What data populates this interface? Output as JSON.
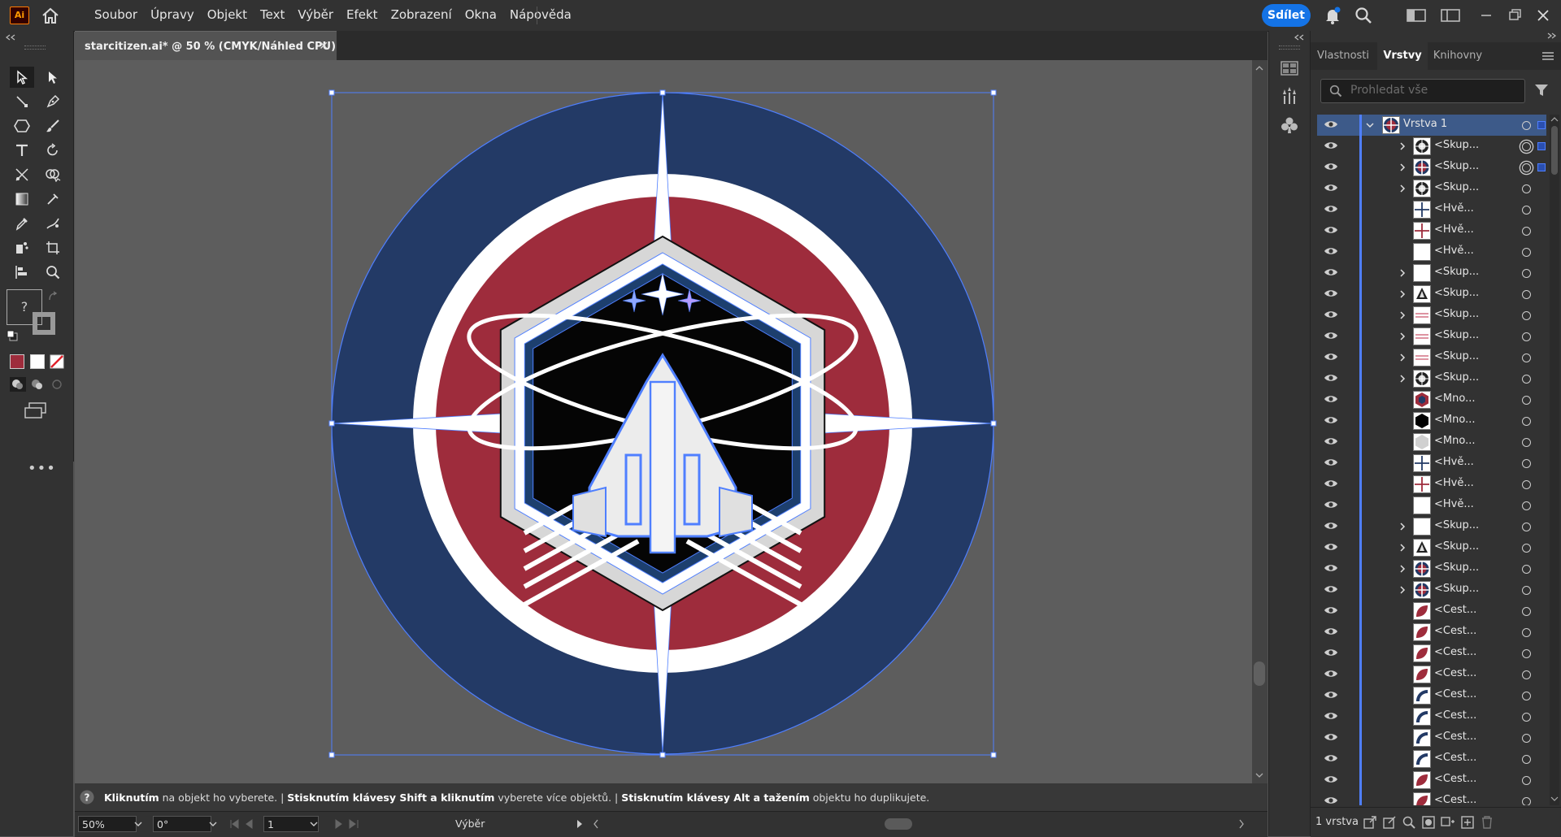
{
  "app": {
    "logo": "Ai"
  },
  "menu": [
    "Soubor",
    "Úpravy",
    "Objekt",
    "Text",
    "Výběr",
    "Efekt",
    "Zobrazení",
    "Okna",
    "Nápověda"
  ],
  "share_label": "Sdílet",
  "document": {
    "tab_title": "starcitizen.ai* @ 50 % (CMYK/Náhled CPU)",
    "close": "✕"
  },
  "colors": {
    "navy": "#233a66",
    "red": "#9e2c3c",
    "white": "#ffffff",
    "accent": "#1473e6",
    "selection": "#4f7fff"
  },
  "hint": {
    "p1b": "Kliknutím",
    "p1": " na objekt ho vyberete.  |  ",
    "p2b": "Stisknutím klávesy Shift a kliknutím",
    "p2": " vyberete více objektů.  |  ",
    "p3b": "Stisknutím klávesy Alt a tažením",
    "p3": " objektu ho duplikujete."
  },
  "status": {
    "zoom": "50%",
    "rotation": "0°",
    "artboard": "1",
    "tool": "Výběr"
  },
  "panel": {
    "tabs": [
      "Vlastnosti",
      "Vrstvy",
      "Knihovny"
    ],
    "active_tab": "Vrstvy",
    "search_placeholder": "Prohledat vše",
    "layer_count": "1 vrstva",
    "layers": [
      {
        "name": "Vrstva 1",
        "level": 0,
        "expand": "down",
        "thumb": "emblem",
        "target": "ring-dot",
        "sel": true
      },
      {
        "name": "<Skup...",
        "level": 1,
        "expand": "right",
        "thumb": "gear",
        "target": "double",
        "sel": true
      },
      {
        "name": "<Skup...",
        "level": 1,
        "expand": "right",
        "thumb": "redcircle",
        "target": "double",
        "sel": true
      },
      {
        "name": "<Skup...",
        "level": 1,
        "expand": "right",
        "thumb": "gear",
        "target": "single"
      },
      {
        "name": "<Hvě...",
        "level": 1,
        "expand": "",
        "thumb": "cross-blue",
        "target": "single"
      },
      {
        "name": "<Hvě...",
        "level": 1,
        "expand": "",
        "thumb": "cross-red",
        "target": "single"
      },
      {
        "name": "<Hvě...",
        "level": 1,
        "expand": "",
        "thumb": "white",
        "target": "single"
      },
      {
        "name": "<Skup...",
        "level": 1,
        "expand": "right",
        "thumb": "white",
        "target": "single"
      },
      {
        "name": "<Skup...",
        "level": 1,
        "expand": "right",
        "thumb": "ship",
        "target": "single"
      },
      {
        "name": "<Skup...",
        "level": 1,
        "expand": "right",
        "thumb": "lines-red",
        "target": "single"
      },
      {
        "name": "<Skup...",
        "level": 1,
        "expand": "right",
        "thumb": "lines-red",
        "target": "single"
      },
      {
        "name": "<Skup...",
        "level": 1,
        "expand": "right",
        "thumb": "lines-red",
        "target": "single"
      },
      {
        "name": "<Skup...",
        "level": 1,
        "expand": "right",
        "thumb": "gear",
        "target": "single"
      },
      {
        "name": "<Mno...",
        "level": 1,
        "expand": "",
        "thumb": "hex-red",
        "target": "single"
      },
      {
        "name": "<Mno...",
        "level": 1,
        "expand": "",
        "thumb": "hex-black",
        "target": "single"
      },
      {
        "name": "<Mno...",
        "level": 1,
        "expand": "",
        "thumb": "hex-grey",
        "target": "single"
      },
      {
        "name": "<Hvě...",
        "level": 1,
        "expand": "",
        "thumb": "cross-blue",
        "target": "single"
      },
      {
        "name": "<Hvě...",
        "level": 1,
        "expand": "",
        "thumb": "cross-red",
        "target": "single"
      },
      {
        "name": "<Hvě...",
        "level": 1,
        "expand": "",
        "thumb": "white",
        "target": "single"
      },
      {
        "name": "<Skup...",
        "level": 1,
        "expand": "right",
        "thumb": "white",
        "target": "single"
      },
      {
        "name": "<Skup...",
        "level": 1,
        "expand": "right",
        "thumb": "ship",
        "target": "single"
      },
      {
        "name": "<Skup...",
        "level": 1,
        "expand": "right",
        "thumb": "redcircle",
        "target": "single"
      },
      {
        "name": "<Skup...",
        "level": 1,
        "expand": "right",
        "thumb": "redcircle",
        "target": "single"
      },
      {
        "name": "<Cest...",
        "level": 1,
        "expand": "",
        "thumb": "leaf-red",
        "target": "single"
      },
      {
        "name": "<Cest...",
        "level": 1,
        "expand": "",
        "thumb": "leaf-red",
        "target": "single"
      },
      {
        "name": "<Cest...",
        "level": 1,
        "expand": "",
        "thumb": "leaf-red",
        "target": "single"
      },
      {
        "name": "<Cest...",
        "level": 1,
        "expand": "",
        "thumb": "leaf-red",
        "target": "single"
      },
      {
        "name": "<Cest...",
        "level": 1,
        "expand": "",
        "thumb": "arc-navy",
        "target": "single"
      },
      {
        "name": "<Cest...",
        "level": 1,
        "expand": "",
        "thumb": "arc-navy",
        "target": "single"
      },
      {
        "name": "<Cest...",
        "level": 1,
        "expand": "",
        "thumb": "arc-navy",
        "target": "single"
      },
      {
        "name": "<Cest...",
        "level": 1,
        "expand": "",
        "thumb": "arc-navy",
        "target": "single"
      },
      {
        "name": "<Cest...",
        "level": 1,
        "expand": "",
        "thumb": "leaf-red",
        "target": "single"
      },
      {
        "name": "<Cest...",
        "level": 1,
        "expand": "",
        "thumb": "leaf-red",
        "target": "single"
      }
    ]
  }
}
